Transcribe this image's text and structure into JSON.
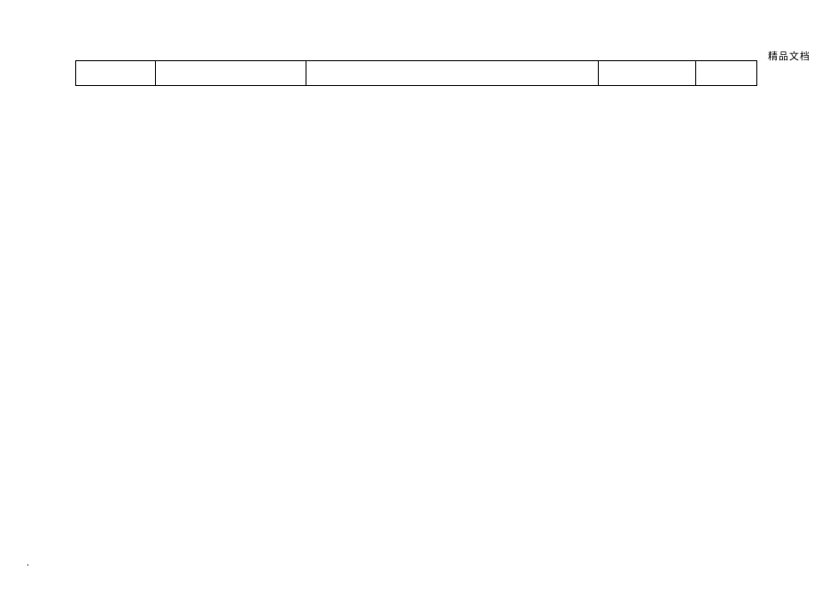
{
  "header": {
    "watermark": "精品文档"
  },
  "table": {
    "rows": [
      {
        "c1": "",
        "c2": "",
        "c3": "",
        "c4": "",
        "c5": ""
      }
    ]
  },
  "footer": {
    "mark": "."
  }
}
